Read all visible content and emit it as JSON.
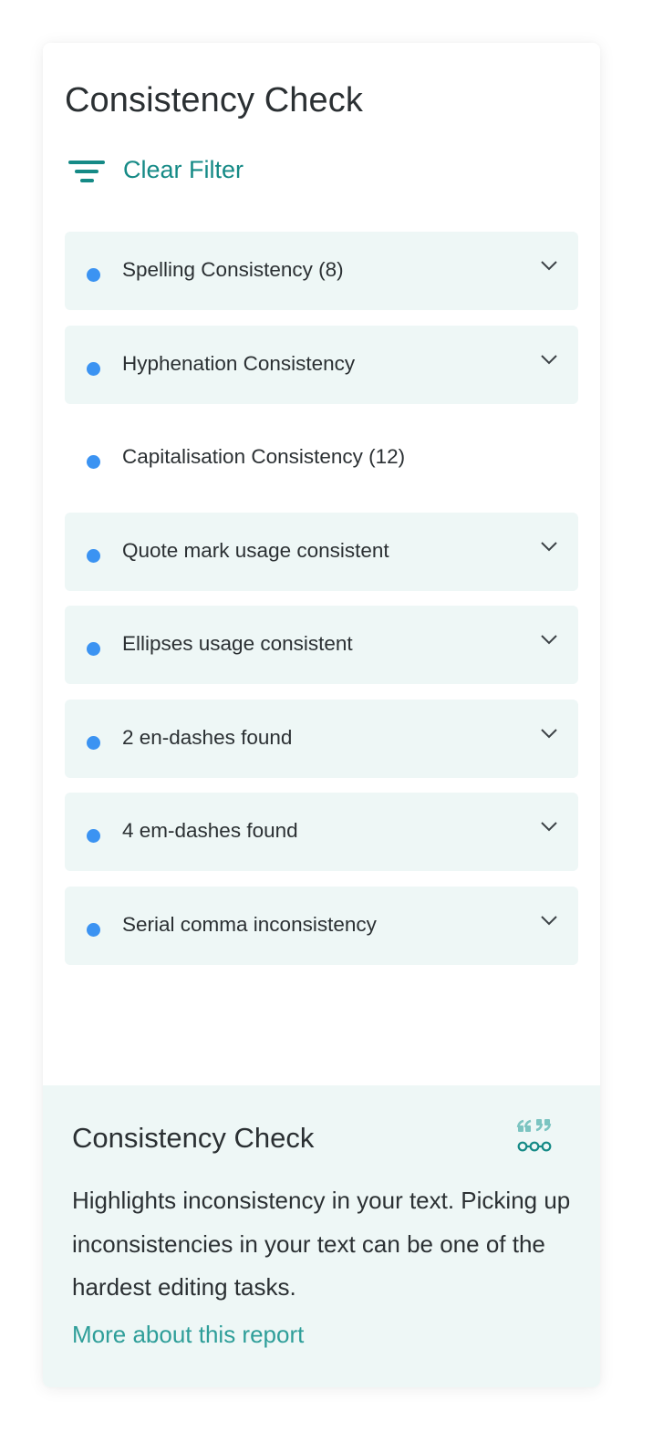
{
  "panel": {
    "title": "Consistency Check",
    "clear_filter_label": "Clear Filter",
    "filter_icon": "filter-icon"
  },
  "items": [
    {
      "label": "Spelling Consistency (8)",
      "expandable": true
    },
    {
      "label": "Hyphenation Consistency",
      "expandable": true
    },
    {
      "label": "Capitalisation Consistency (12)",
      "expandable": false
    },
    {
      "label": "Quote mark usage consistent",
      "expandable": true
    },
    {
      "label": "Ellipses usage consistent",
      "expandable": true
    },
    {
      "label": "2 en-dashes found",
      "expandable": true
    },
    {
      "label": "4 em-dashes found",
      "expandable": true
    },
    {
      "label": "Serial comma inconsistency",
      "expandable": true
    }
  ],
  "info": {
    "title": "Consistency Check",
    "icon": "quote-marks-icon",
    "description": "Highlights inconsistency in your text. Picking up inconsistencies in your text can be one of the hardest editing tasks.",
    "link_label": "More about this report"
  },
  "colors": {
    "accent": "#158a86",
    "link": "#2e9e99",
    "dot": "#3b93f2",
    "item_bg": "#eef7f6",
    "text": "#2b3033"
  }
}
